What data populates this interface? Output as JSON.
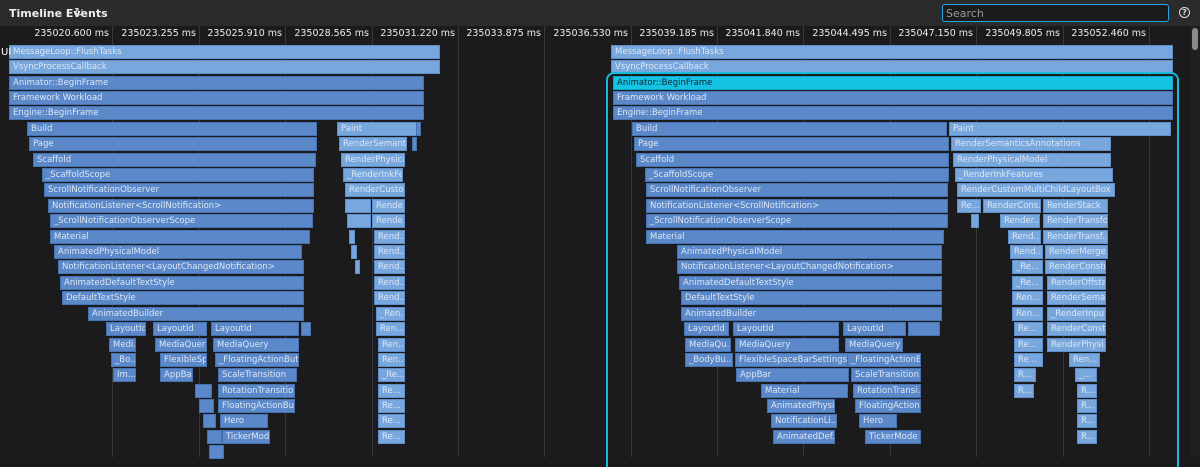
{
  "toolbar": {
    "title": "Timeline Events",
    "refresh_icon": "refresh-icon",
    "search_placeholder": "Search",
    "help_icon": "help-icon"
  },
  "track_label": "UI",
  "ruler_ticks": [
    "235020.600 ms",
    "235023.255 ms",
    "235025.910 ms",
    "235028.565 ms",
    "235031.220 ms",
    "235033.875 ms",
    "235036.530 ms",
    "235039.185 ms",
    "235041.840 ms",
    "235044.495 ms",
    "235047.150 ms",
    "235049.805 ms",
    "235052.460 ms"
  ],
  "events": [
    {
      "label": "MessageLoop::FlushTasks",
      "c": "light"
    },
    {
      "label": "VsyncProcessCallback",
      "c": "light"
    },
    {
      "label": "Animator::BeginFrame",
      "c": ""
    },
    {
      "label": "Framework Workload",
      "c": ""
    },
    {
      "label": "Engine::BeginFrame",
      "c": ""
    },
    {
      "label": "Build",
      "c": ""
    },
    {
      "label": "Paint",
      "c": "light"
    },
    {
      "label": "",
      "c": ""
    },
    {
      "label": "Page",
      "c": ""
    },
    {
      "label": "RenderSemanti...",
      "c": "light"
    },
    {
      "label": "",
      "c": ""
    },
    {
      "label": "Scaffold",
      "c": ""
    },
    {
      "label": "RenderPhysica...",
      "c": "light"
    },
    {
      "label": "_ScaffoldScope",
      "c": ""
    },
    {
      "label": "_RenderInkFe...",
      "c": "light"
    },
    {
      "label": "ScrollNotificationObserver",
      "c": ""
    },
    {
      "label": "RenderCusto...",
      "c": "light"
    },
    {
      "label": "NotificationListener<ScrollNotification>",
      "c": ""
    },
    {
      "label": "",
      "c": "light"
    },
    {
      "label": "Rende...",
      "c": "light"
    },
    {
      "label": "_ScrollNotificationObserverScope",
      "c": ""
    },
    {
      "label": "",
      "c": "light"
    },
    {
      "label": "Rende...",
      "c": "light"
    },
    {
      "label": "Material",
      "c": ""
    },
    {
      "label": "",
      "c": "light"
    },
    {
      "label": "Rend...",
      "c": "light"
    },
    {
      "label": "AnimatedPhysicalModel",
      "c": ""
    },
    {
      "label": "",
      "c": "light"
    },
    {
      "label": "Rend...",
      "c": "light"
    },
    {
      "label": "NotificationListener<LayoutChangedNotification>",
      "c": ""
    },
    {
      "label": "",
      "c": "light"
    },
    {
      "label": "Rend...",
      "c": "light"
    },
    {
      "label": "AnimatedDefaultTextStyle",
      "c": ""
    },
    {
      "label": "Rend...",
      "c": "light"
    },
    {
      "label": "DefaultTextStyle",
      "c": ""
    },
    {
      "label": "Rend...",
      "c": "light"
    },
    {
      "label": "AnimatedBuilder",
      "c": ""
    },
    {
      "label": "_Ren...",
      "c": "light"
    },
    {
      "label": "LayoutId",
      "c": ""
    },
    {
      "label": "LayoutId",
      "c": ""
    },
    {
      "label": "LayoutId",
      "c": ""
    },
    {
      "label": "",
      "c": ""
    },
    {
      "label": "Ren...",
      "c": "light"
    },
    {
      "label": "Medi...",
      "c": ""
    },
    {
      "label": "MediaQuery",
      "c": ""
    },
    {
      "label": "MediaQuery",
      "c": ""
    },
    {
      "label": "Ren...",
      "c": "light"
    },
    {
      "label": "_Bo...",
      "c": ""
    },
    {
      "label": "FlexibleSp...",
      "c": ""
    },
    {
      "label": "_FloatingActionButt...",
      "c": ""
    },
    {
      "label": "Ren...",
      "c": "light"
    },
    {
      "label": "Im...",
      "c": ""
    },
    {
      "label": "AppBar",
      "c": ""
    },
    {
      "label": "ScaleTransition",
      "c": ""
    },
    {
      "label": "_Re...",
      "c": "light"
    },
    {
      "label": "",
      "c": ""
    },
    {
      "label": "RotationTransition",
      "c": ""
    },
    {
      "label": "Re...",
      "c": "light"
    },
    {
      "label": "",
      "c": ""
    },
    {
      "label": "FloatingActionBut...",
      "c": ""
    },
    {
      "label": "Re...",
      "c": "light"
    },
    {
      "label": "",
      "c": ""
    },
    {
      "label": "Hero",
      "c": ""
    },
    {
      "label": "Re...",
      "c": "light"
    },
    {
      "label": "",
      "c": ""
    },
    {
      "label": "TickerMode",
      "c": ""
    },
    {
      "label": "Re...",
      "c": "light"
    },
    {
      "label": "",
      "c": ""
    },
    {
      "label": "MessageLoop::FlushTasks",
      "c": "light"
    },
    {
      "label": "VsyncProcessCallback",
      "c": "light"
    },
    {
      "label": "Animator::BeginFrame",
      "c": "sel"
    },
    {
      "label": "Framework Workload",
      "c": ""
    },
    {
      "label": "Engine::BeginFrame",
      "c": ""
    },
    {
      "label": "Build",
      "c": ""
    },
    {
      "label": "Paint",
      "c": "light"
    },
    {
      "label": "Page",
      "c": ""
    },
    {
      "label": "RenderSemanticsAnnotations",
      "c": "light"
    },
    {
      "label": "Scaffold",
      "c": ""
    },
    {
      "label": "RenderPhysicalModel",
      "c": "light"
    },
    {
      "label": "_ScaffoldScope",
      "c": ""
    },
    {
      "label": "_RenderInkFeatures",
      "c": "light"
    },
    {
      "label": "ScrollNotificationObserver",
      "c": ""
    },
    {
      "label": "RenderCustomMultiChildLayoutBox",
      "c": "light"
    },
    {
      "label": "NotificationListener<ScrollNotification>",
      "c": ""
    },
    {
      "label": "Re...",
      "c": "light"
    },
    {
      "label": "RenderCons...",
      "c": "light"
    },
    {
      "label": "RenderStack",
      "c": "light"
    },
    {
      "label": "_ScrollNotificationObserverScope",
      "c": ""
    },
    {
      "label": "",
      "c": "light"
    },
    {
      "label": "Render...",
      "c": "light"
    },
    {
      "label": "RenderTransfo...",
      "c": "light"
    },
    {
      "label": "Material",
      "c": ""
    },
    {
      "label": "Rend...",
      "c": "light"
    },
    {
      "label": "RenderTransf...",
      "c": "light"
    },
    {
      "label": "AnimatedPhysicalModel",
      "c": ""
    },
    {
      "label": "Rend...",
      "c": "light"
    },
    {
      "label": "RenderMerge...",
      "c": "light"
    },
    {
      "label": "NotificationListener<LayoutChangedNotification>",
      "c": ""
    },
    {
      "label": "_Re...",
      "c": "light"
    },
    {
      "label": "RenderConstr...",
      "c": "light"
    },
    {
      "label": "AnimatedDefaultTextStyle",
      "c": ""
    },
    {
      "label": "_Re...",
      "c": "light"
    },
    {
      "label": "RenderOffsta...",
      "c": "light"
    },
    {
      "label": "DefaultTextStyle",
      "c": ""
    },
    {
      "label": "Ren...",
      "c": "light"
    },
    {
      "label": "RenderSema...",
      "c": "light"
    },
    {
      "label": "AnimatedBuilder",
      "c": ""
    },
    {
      "label": "Ren...",
      "c": "light"
    },
    {
      "label": "_RenderInpu...",
      "c": "light"
    },
    {
      "label": "LayoutId",
      "c": ""
    },
    {
      "label": "LayoutId",
      "c": ""
    },
    {
      "label": "LayoutId",
      "c": ""
    },
    {
      "label": "",
      "c": ""
    },
    {
      "label": "Re...",
      "c": "light"
    },
    {
      "label": "RenderConst...",
      "c": "light"
    },
    {
      "label": "MediaQu...",
      "c": ""
    },
    {
      "label": "MediaQuery",
      "c": ""
    },
    {
      "label": "MediaQuery",
      "c": ""
    },
    {
      "label": "Re...",
      "c": "light"
    },
    {
      "label": "RenderPhysi...",
      "c": "light"
    },
    {
      "label": "_BodyBu...",
      "c": ""
    },
    {
      "label": "FlexibleSpaceBarSettings",
      "c": ""
    },
    {
      "label": "_FloatingActionB...",
      "c": ""
    },
    {
      "label": "Re...",
      "c": "light"
    },
    {
      "label": "Ren...",
      "c": "light"
    },
    {
      "label": "AppBar",
      "c": ""
    },
    {
      "label": "ScaleTransition",
      "c": ""
    },
    {
      "label": "R...",
      "c": "light"
    },
    {
      "label": "_...",
      "c": "light"
    },
    {
      "label": "Material",
      "c": ""
    },
    {
      "label": "RotationTransi...",
      "c": ""
    },
    {
      "label": "R...",
      "c": "light"
    },
    {
      "label": "R...",
      "c": "light"
    },
    {
      "label": "AnimatedPhysi...",
      "c": ""
    },
    {
      "label": "FloatingAction...",
      "c": ""
    },
    {
      "label": "R...",
      "c": "light"
    },
    {
      "label": "NotificationLi...",
      "c": ""
    },
    {
      "label": "Hero",
      "c": ""
    },
    {
      "label": "R...",
      "c": "light"
    },
    {
      "label": "AnimatedDef...",
      "c": ""
    },
    {
      "label": "TickerMode",
      "c": ""
    },
    {
      "label": "R...",
      "c": "light"
    }
  ]
}
